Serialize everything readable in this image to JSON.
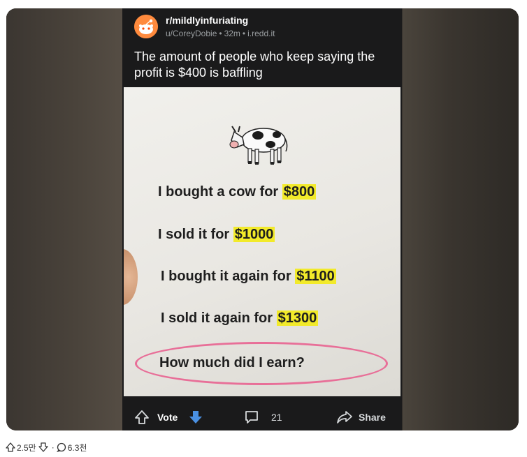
{
  "post": {
    "subreddit": "r/mildlyinfuriating",
    "author": "u/CoreyDobie",
    "age": "32m",
    "domain": "i.redd.it",
    "title": "The amount of people who keep saying the profit is $400 is baffling"
  },
  "image_text": {
    "line1": {
      "text": "I bought a cow for ",
      "amount": "$800"
    },
    "line2": {
      "text": "I sold it for ",
      "amount": "$1000"
    },
    "line3": {
      "text": "I bought it again for ",
      "amount": "$1100"
    },
    "line4": {
      "text": "I sold it again for ",
      "amount": "$1300"
    },
    "question": "How much did I earn?"
  },
  "actions": {
    "vote_label": "Vote",
    "comment_count": "21",
    "share_label": "Share"
  },
  "stats": {
    "upvotes": "2.5만",
    "separator": "·",
    "comments": "6.3천"
  },
  "colors": {
    "vote_accent": "#4a90e2",
    "highlight": "#f2ea2a",
    "circle": "#e86f98",
    "avatar": "#ff8a3d"
  }
}
